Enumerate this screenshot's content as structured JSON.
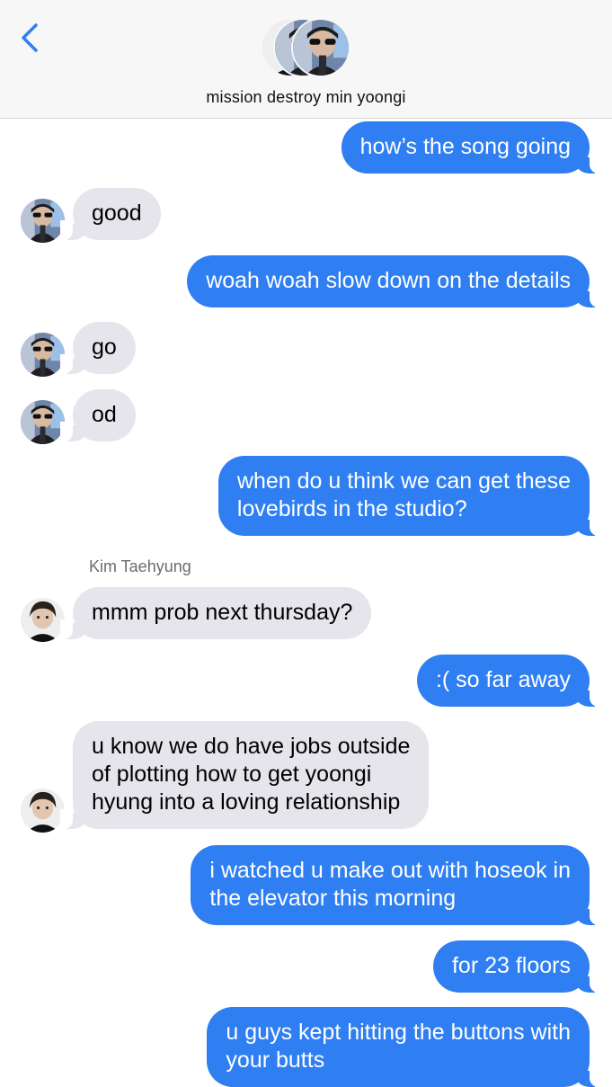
{
  "conversation": {
    "title": "mission destroy min yoongi",
    "back_icon": "chevron-left-icon",
    "accent_color": "#2f7ff2",
    "received_color": "#e6e5eb"
  },
  "sender_name": "Kim Taehyung",
  "messages": [
    {
      "side": "sent",
      "text": "how’s the song going"
    },
    {
      "side": "received",
      "text": "good"
    },
    {
      "side": "sent",
      "text": "woah woah slow down on the details"
    },
    {
      "side": "received",
      "text": "go"
    },
    {
      "side": "received",
      "text": "od"
    },
    {
      "side": "sent",
      "text": "when do u think we can get these\nlovebirds in the studio?"
    },
    {
      "side": "received",
      "text": "mmm prob next thursday?"
    },
    {
      "side": "sent",
      "text": ":( so far away"
    },
    {
      "side": "received",
      "text": "u know we do have jobs outside\nof plotting how to get yoongi\nhyung into a loving relationship"
    },
    {
      "side": "sent",
      "text": "i watched u make out with hoseok in\nthe elevator this morning"
    },
    {
      "side": "sent",
      "text": "for 23 floors"
    },
    {
      "side": "sent",
      "text": "u guys kept hitting the buttons with\nyour butts"
    }
  ]
}
